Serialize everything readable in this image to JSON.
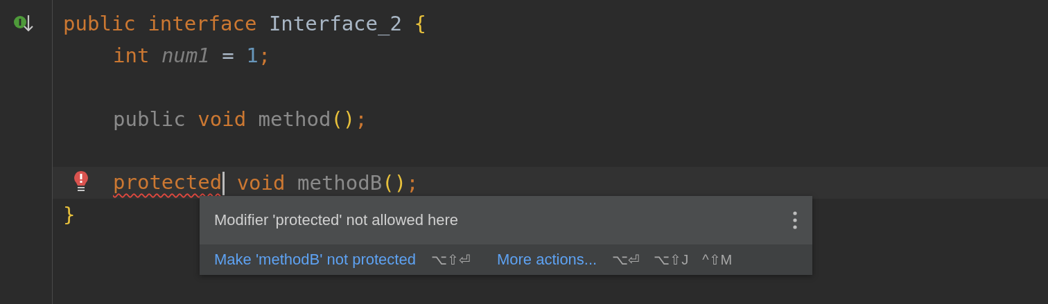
{
  "editor": {
    "header": {
      "marker": {
        "kind": "implemented"
      },
      "tokens": [
        {
          "kind": "keyword",
          "text": "public"
        },
        {
          "kind": "keyword",
          "text": "interface"
        },
        {
          "kind": "name",
          "text": "Interface_2"
        },
        {
          "kind": "brace",
          "text": "{"
        }
      ]
    },
    "members": [
      {
        "tokens": [
          {
            "kind": "keyword",
            "text": "int"
          },
          {
            "kind": "field",
            "text": "num1"
          },
          {
            "kind": "name",
            "text": "="
          },
          {
            "kind": "number",
            "text": "1"
          },
          {
            "kind": "punct",
            "text": ";"
          }
        ]
      },
      {
        "tokens": [
          {
            "kind": "muted",
            "text": "public"
          },
          {
            "kind": "keyword",
            "text": "void"
          },
          {
            "kind": "muted",
            "text": "method"
          },
          {
            "kind": "paren",
            "text": "()"
          },
          {
            "kind": "punct",
            "text": ";"
          }
        ]
      },
      {
        "current": true,
        "marker": {
          "kind": "error-bulb"
        },
        "tokens": [
          {
            "kind": "keyword",
            "text": "protected",
            "error": true,
            "caret": true
          },
          {
            "kind": "keyword",
            "text": "void"
          },
          {
            "kind": "muted",
            "text": "methodB"
          },
          {
            "kind": "paren",
            "text": "()"
          },
          {
            "kind": "punct",
            "text": ";"
          }
        ]
      }
    ],
    "footer": {
      "tokens": [
        {
          "kind": "brace",
          "text": "}"
        }
      ]
    }
  },
  "popup": {
    "message": "Modifier 'protected' not allowed here",
    "actions": [
      {
        "label": "Make 'methodB' not protected",
        "shortcuts": [
          "⌥⇧⏎"
        ]
      },
      {
        "label": "More actions...",
        "shortcuts": [
          "⌥⏎",
          "⌥⇧J",
          "^⇧M"
        ]
      }
    ]
  }
}
